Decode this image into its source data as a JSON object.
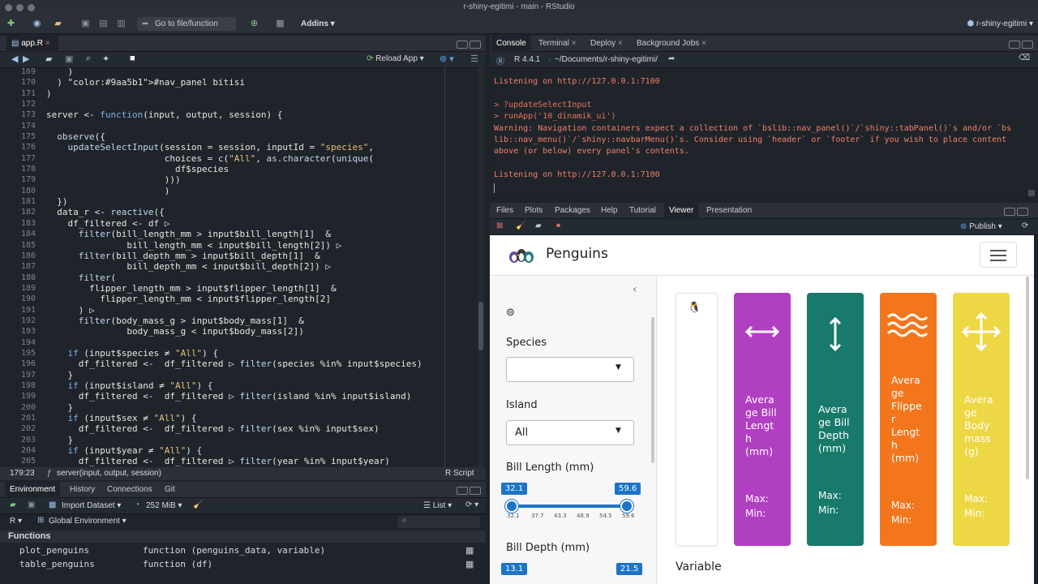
{
  "window": {
    "title": "r-shiny-egitimi - main - RStudio"
  },
  "toolbar": {
    "goto_placeholder": "Go to file/function",
    "addins_label": "Addins",
    "project_label": "r-shiny-egitimi"
  },
  "editor": {
    "file_tab": "app.R",
    "reload_label": "Reload App",
    "line_numbers": [
      "169",
      "170",
      "171",
      "172",
      "173",
      "174",
      "175",
      "176",
      "177",
      "178",
      "179",
      "180",
      "181",
      "182",
      "183",
      "184",
      "185",
      "186",
      "187",
      "188",
      "189",
      "190",
      "191",
      "192",
      "193",
      "194",
      "195",
      "196",
      "197",
      "198",
      "199",
      "200",
      "201",
      "202",
      "203",
      "204",
      "205"
    ],
    "code_lines": [
      "    )",
      "  ) #nav_panel bitisi",
      ")",
      "",
      "server <- function(input, output, session) {",
      "",
      "  observe({",
      "    updateSelectInput(session = session, inputId = \"species\",",
      "                      choices = c(\"All\", as.character(unique(",
      "                        df$species",
      "                      )))",
      "                      )",
      "  })",
      "  data_r <- reactive({",
      "    df_filtered <- df ▷",
      "      filter(bill_length_mm > input$bill_length[1]  &",
      "               bill_length_mm < input$bill_length[2]) ▷",
      "      filter(bill_depth_mm > input$bill_depth[1]  &",
      "               bill_depth_mm < input$bill_depth[2]) ▷",
      "      filter(",
      "        flipper_length_mm > input$flipper_length[1]  &",
      "          flipper_length_mm < input$flipper_length[2]",
      "      ) ▷",
      "      filter(body_mass_g > input$body_mass[1]  &",
      "               body_mass_g < input$body_mass[2])",
      "",
      "    if (input$species ≠ \"All\") {",
      "      df_filtered <-  df_filtered ▷ filter(species %in% input$species)",
      "    }",
      "    if (input$island ≠ \"All\") {",
      "      df_filtered <-  df_filtered ▷ filter(island %in% input$island)",
      "    }",
      "    if (input$sex ≠ \"All\") {",
      "      df_filtered <-  df_filtered ▷ filter(sex %in% input$sex)",
      "    }",
      "    if (input$year ≠ \"All\") {",
      "      df_filtered <-  df_filtered ▷ filter(year %in% input$year)"
    ],
    "status_position": "179:23",
    "status_scope": "server(input, output, session)",
    "status_filetype": "R Script"
  },
  "environment": {
    "tabs": [
      "Environment",
      "History",
      "Connections",
      "Git"
    ],
    "import_label": "Import Dataset",
    "memory_label": "252 MiB",
    "list_label": "List",
    "lang_label": "R",
    "scope_label": "Global Environment",
    "section_label": "Functions",
    "rows": [
      {
        "name": "plot_penguins",
        "value": "function (penguins_data, variable)"
      },
      {
        "name": "table_penguins",
        "value": "function (df)"
      }
    ]
  },
  "console": {
    "tabs": [
      "Console",
      "Terminal",
      "Deploy",
      "Background Jobs"
    ],
    "r_version": "R 4.4.1",
    "path": "~/Documents/r-shiny-egitimi/",
    "lines": [
      {
        "text": "Listening on http://127.0.0.1:7100",
        "kind": "out"
      },
      {
        "text": "",
        "kind": "out"
      },
      {
        "text": "> ?updateSelectInput",
        "kind": "cmd"
      },
      {
        "text": "> runApp('10_dinamik_ui')",
        "kind": "cmd"
      },
      {
        "text": "Warning: Navigation containers expect a collection of `bslib::nav_panel()`/`shiny::tabPanel()`s and/or `bs",
        "kind": "out"
      },
      {
        "text": "lib::nav_menu()`/`shiny::navbarMenu()`s. Consider using `header` or `footer` if you wish to place content",
        "kind": "out"
      },
      {
        "text": "above (or below) every panel's contents.",
        "kind": "out"
      },
      {
        "text": "",
        "kind": "out"
      },
      {
        "text": "Listening on http://127.0.0.1:7100",
        "kind": "out"
      }
    ]
  },
  "viewer": {
    "tabs": [
      "Files",
      "Plots",
      "Packages",
      "Help",
      "Tutorial",
      "Viewer",
      "Presentation"
    ],
    "publish_label": "Publish",
    "app": {
      "title": "Penguins",
      "species_label": "Species",
      "species_value": "",
      "island_label": "Island",
      "island_value": "All",
      "bill_length_label": "Bill Length (mm)",
      "bill_length_min": "32.1",
      "bill_length_max": "59.6",
      "bill_length_ticks": [
        "32.1",
        "37.7",
        "43.3",
        "48.9",
        "54.5",
        "59.6"
      ],
      "bill_depth_label": "Bill Depth (mm)",
      "bill_depth_min": "13.1",
      "bill_depth_max": "21.5",
      "variable_label": "Variable",
      "cards": [
        {
          "title": "Avera\nge Bill\nLengt\nh\n(mm)",
          "max": "Max:",
          "min": "Min:",
          "color": "#b13fc2",
          "icon": "arrows-horizontal-icon"
        },
        {
          "title": "Avera\nge Bill\nDepth\n(mm)",
          "max": "Max:",
          "min": "Min:",
          "color": "#177a6b",
          "icon": "arrows-vertical-icon"
        },
        {
          "title": "Avera\nge\nFlippe\nr\nLengt\nh\n(mm)",
          "max": "Max:",
          "min": "Min:",
          "color": "#f3761c",
          "icon": "waves-icon"
        },
        {
          "title": "Avera\nge\nBody\nmass\n(g)",
          "max": "Max:",
          "min": "Min:",
          "color": "#eed744",
          "icon": "arrows-all-icon"
        }
      ]
    }
  }
}
